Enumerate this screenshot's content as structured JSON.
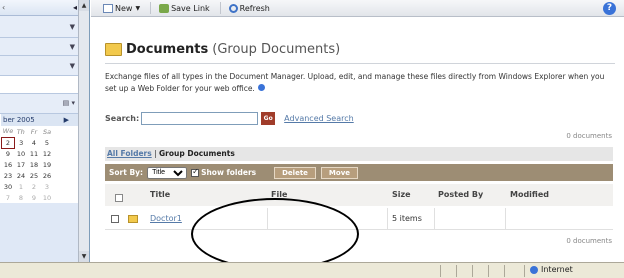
{
  "toolbar": {
    "new_label": "New",
    "save_link_label": "Save Link",
    "refresh_label": "Refresh"
  },
  "page": {
    "title": "Documents",
    "subtitle": "(Group Documents)",
    "description": "Exchange files of all types in the Document Manager. Upload, edit, and manage these files directly from Windows Explorer when you set up a Web Folder for your web office."
  },
  "search": {
    "label": "Search:",
    "value": "",
    "go_label": "Go",
    "advanced_label": "Advanced Search",
    "doc_count_top": "0 documents"
  },
  "folders": {
    "all_label": "All Folders",
    "separator": "|",
    "current": "Group Documents"
  },
  "sortbar": {
    "sort_by_label": "Sort By:",
    "sort_value": "Title",
    "show_folders_label": "Show folders",
    "delete_label": "Delete",
    "move_label": "Move"
  },
  "table": {
    "columns": [
      "Title",
      "File",
      "Size",
      "Posted By",
      "Modified"
    ],
    "rows": [
      {
        "title": "Doctor1",
        "file": "",
        "size": "5 items",
        "posted_by": "",
        "modified": ""
      }
    ],
    "doc_count_bottom": "0 documents"
  },
  "calendar": {
    "month_label": "ber 2005",
    "day_headers": [
      "We",
      "Th",
      "Fr",
      "Sa"
    ],
    "weeks": [
      [
        "2",
        "3",
        "4",
        "5"
      ],
      [
        "9",
        "10",
        "11",
        "12"
      ],
      [
        "16",
        "17",
        "18",
        "19"
      ],
      [
        "23",
        "24",
        "25",
        "26"
      ],
      [
        "30",
        "1",
        "2",
        "3"
      ],
      [
        "7",
        "8",
        "9",
        "10"
      ]
    ]
  },
  "statusbar": {
    "zone_label": "Internet"
  },
  "colors": {
    "sortbar_bg": "#9d8d74",
    "link": "#557aa8",
    "go_button": "#a03c2a"
  }
}
